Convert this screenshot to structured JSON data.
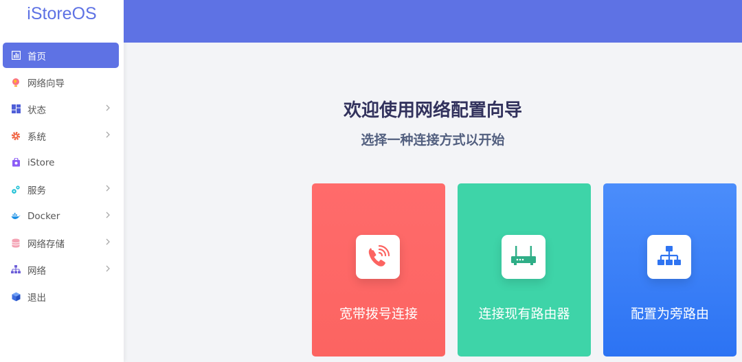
{
  "brand": {
    "title": "iStoreOS"
  },
  "sidebar": {
    "items": [
      {
        "label": "首页",
        "icon": "dashboard-icon",
        "active": true,
        "submenu": false
      },
      {
        "label": "网络向导",
        "icon": "globe-icon",
        "active": false,
        "submenu": false
      },
      {
        "label": "状态",
        "icon": "grid-icon",
        "active": false,
        "submenu": true
      },
      {
        "label": "系统",
        "icon": "gear-icon",
        "active": false,
        "submenu": true
      },
      {
        "label": "iStore",
        "icon": "store-bag-icon",
        "active": false,
        "submenu": false
      },
      {
        "label": "服务",
        "icon": "cogs-icon",
        "active": false,
        "submenu": true
      },
      {
        "label": "Docker",
        "icon": "docker-whale-icon",
        "active": false,
        "submenu": true
      },
      {
        "label": "网络存储",
        "icon": "database-icon",
        "active": false,
        "submenu": true
      },
      {
        "label": "网络",
        "icon": "network-tree-icon",
        "active": false,
        "submenu": true
      },
      {
        "label": "退出",
        "icon": "logout-cube-icon",
        "active": false,
        "submenu": false
      }
    ]
  },
  "main": {
    "title": "欢迎使用网络配置向导",
    "subtitle": "选择一种连接方式以开始",
    "cards": [
      {
        "label": "宽带拨号连接",
        "icon": "phone-call-icon",
        "color": "#ff6b6b"
      },
      {
        "label": "连接现有路由器",
        "icon": "router-icon",
        "color": "#3ed4a8"
      },
      {
        "label": "配置为旁路由",
        "icon": "sitemap-icon",
        "color": "#3b82f6"
      }
    ]
  },
  "colors": {
    "accent": "#5e72e4"
  }
}
